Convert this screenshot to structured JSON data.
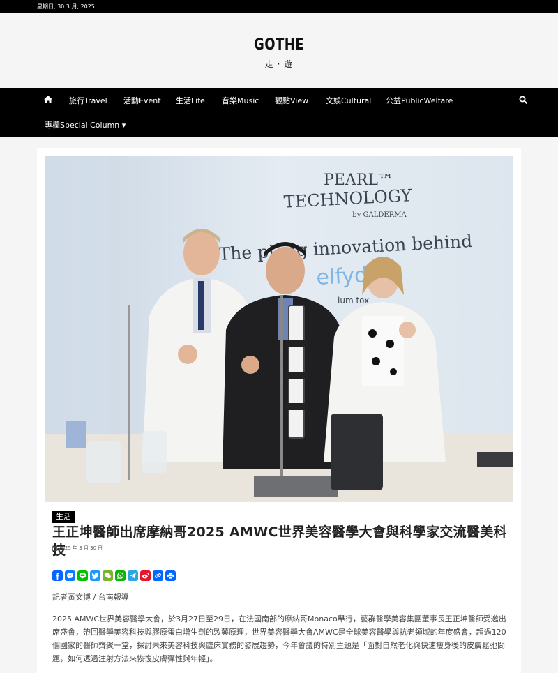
{
  "topbar": {
    "date": "星期日, 30 3 月, 2025"
  },
  "site": {
    "title": "GOTHE",
    "subtitle": "走 · 遊"
  },
  "nav": {
    "home_icon": "home-icon",
    "items": [
      {
        "label": "旅行Travel"
      },
      {
        "label": "活動Event"
      },
      {
        "label": "生活Life"
      },
      {
        "label": "音樂Music"
      },
      {
        "label": "觀點View"
      },
      {
        "label": "文娛Cultural"
      },
      {
        "label": "公益PublicWelfare"
      },
      {
        "label": "專欄Special Column ▾"
      }
    ],
    "search_icon": "search-icon"
  },
  "hero": {
    "banner_line1": "PEARL™",
    "banner_line2": "TECHNOLOGY",
    "banner_line3": "by GALDERMA",
    "tagline": "The pi      ing innovation behind",
    "brand": "elfyd   s",
    "brand_sub": "ium tox"
  },
  "article": {
    "category": "生活",
    "title": "王正坤醫師出席摩納哥2025 AMWC世界美容醫學大會與科學家交流醫美科技",
    "date": "2025 年 3 月 30 日",
    "byline": "記者黃文博 / 台南報導",
    "body": "2025 AMWC世界美容醫學大會，於3月27日至29日，在法國南部的摩納哥Monaco舉行，藝群醫學美容集團董事長王正坤醫師受邀出席盛會，帶回醫學美容科技與膠原蛋白增生劑的製藥原理，世界美容醫學大會AMWC是全球美容醫學與抗老領域的年度盛會，超過120個國家的醫師齊聚一堂，探討未來美容科技與臨床實務的發展趨勢，今年會議的特別主題是「面對自然老化與快速瘦身後的皮膚鬆弛問題，如何透過注射方法來恢復皮膚彈性與年輕」。"
  },
  "share": [
    {
      "name": "facebook",
      "color": "#0866ff"
    },
    {
      "name": "messenger",
      "color": "#0a7cff"
    },
    {
      "name": "line",
      "color": "#00c300"
    },
    {
      "name": "twitter",
      "color": "#1d9bf0"
    },
    {
      "name": "wechat",
      "color": "#7bb32e"
    },
    {
      "name": "whatsapp",
      "color": "#12af0a"
    },
    {
      "name": "telegram",
      "color": "#2ca5e0"
    },
    {
      "name": "weibo",
      "color": "#e6162d"
    },
    {
      "name": "copy-link",
      "color": "#0166ff"
    },
    {
      "name": "print",
      "color": "#0166ff"
    }
  ]
}
